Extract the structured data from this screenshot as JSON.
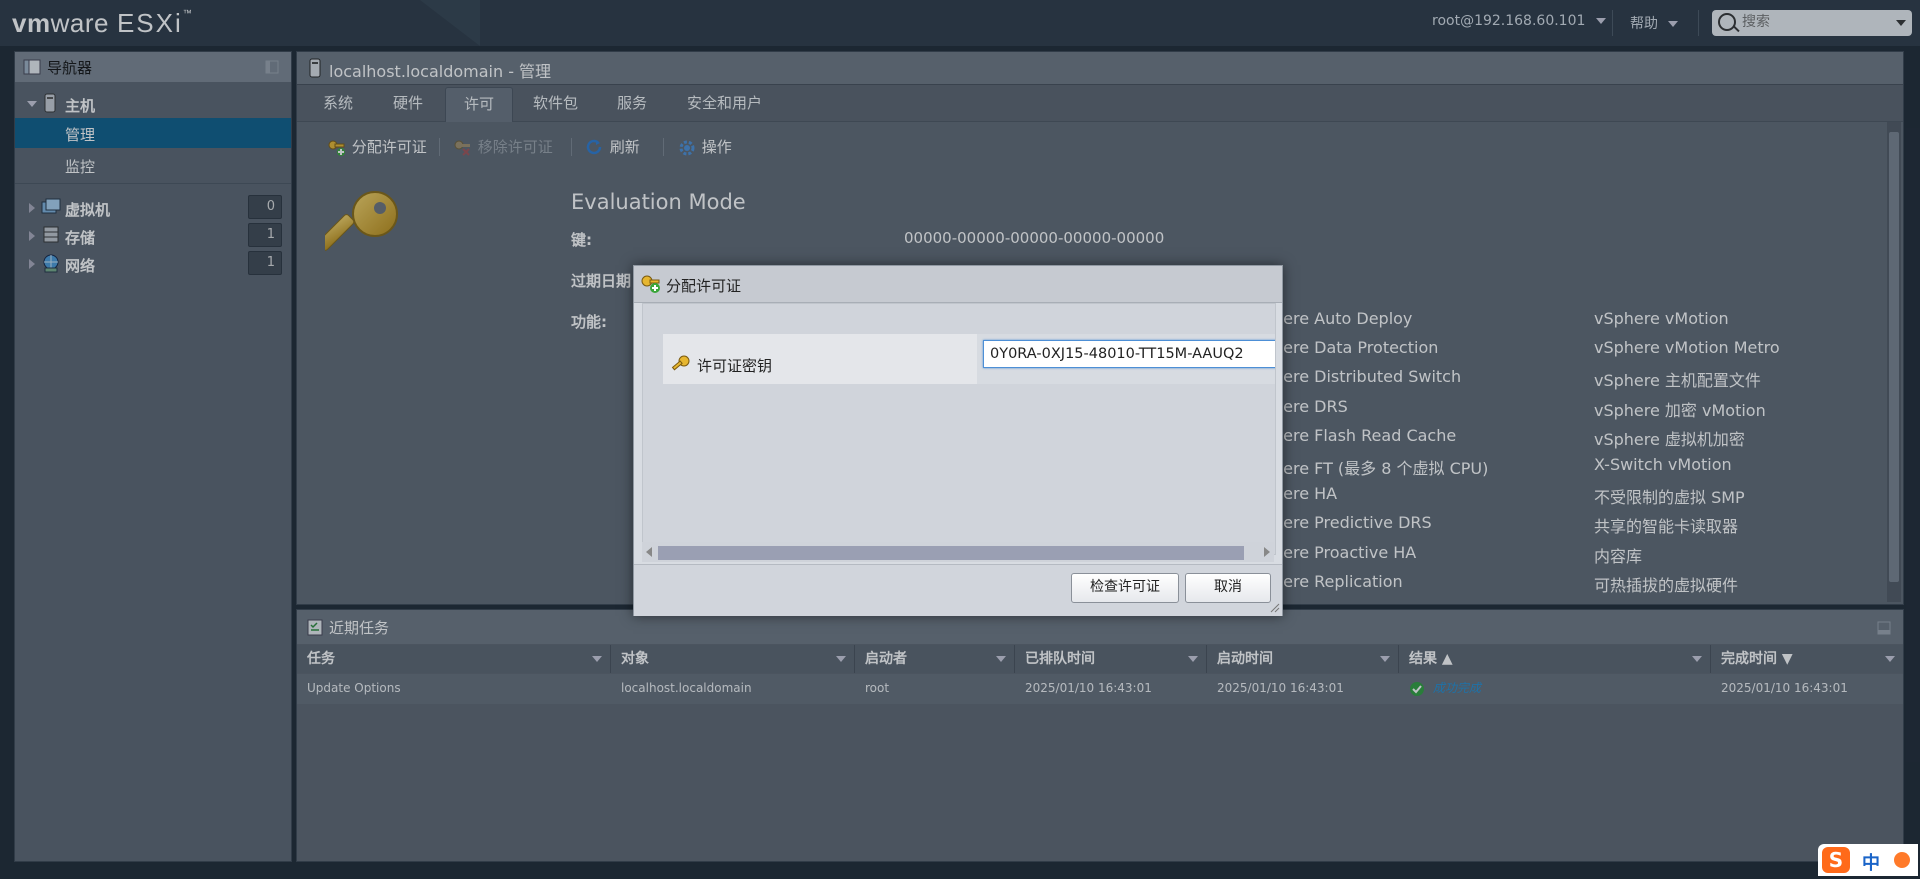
{
  "header": {
    "logo_vm": "vm",
    "logo_ware": "ware",
    "logo_esxi": "ESXi",
    "user": "root@192.168.60.101",
    "help": "帮助",
    "search_placeholder": "搜索"
  },
  "navigator": {
    "title": "导航器",
    "items": [
      {
        "label": "主机"
      },
      {
        "label": "管理"
      },
      {
        "label": "监控"
      },
      {
        "label": "虚拟机",
        "count": "0"
      },
      {
        "label": "存储",
        "count": "1"
      },
      {
        "label": "网络",
        "count": "1"
      }
    ]
  },
  "main": {
    "title": "localhost.localdomain - 管理",
    "tabs": [
      "系统",
      "硬件",
      "许可",
      "软件包",
      "服务",
      "安全和用户"
    ],
    "active_tab": "许可",
    "toolbar": {
      "assign": "分配许可证",
      "remove": "移除许可证",
      "refresh": "刷新",
      "actions": "操作"
    },
    "license": {
      "mode": "Evaluation Mode",
      "key_label": "键:",
      "key_value": "00000-00000-00000-00000-00000",
      "expiry_label": "过期日期",
      "features_label": "功能:",
      "features_col1": [
        "here Auto Deploy",
        "here Data Protection",
        "here Distributed Switch",
        "here DRS",
        "here Flash Read Cache",
        "here FT (最多 8 个虚拟 CPU)",
        "here HA",
        "here Predictive DRS",
        "here Proactive HA",
        "here Replication"
      ],
      "features_col2": [
        "vSphere vMotion",
        "vSphere vMotion Metro",
        "vSphere 主机配置文件",
        "vSphere 加密 vMotion",
        "vSphere 虚拟机加密",
        "X-Switch vMotion",
        "不受限制的虚拟 SMP",
        "共享的智能卡读取器",
        "内容库",
        "可热插拔的虚拟硬件"
      ]
    }
  },
  "tasks": {
    "title": "近期任务",
    "columns": [
      "任务",
      "对象",
      "启动者",
      "已排队时间",
      "启动时间",
      "结果 ▲",
      "完成时间 ▼"
    ],
    "rows": [
      [
        "Update Options",
        "localhost.localdomain",
        "root",
        "2025/01/10 16:43:01",
        "2025/01/10 16:43:01",
        "成功完成",
        "2025/01/10 16:43:01"
      ]
    ]
  },
  "dialog": {
    "title": "分配许可证",
    "field_label": "许可证密钥",
    "field_value": "0Y0RA-0XJ15-48010-TT15M-AAUQ2",
    "check_button": "检查许可证",
    "cancel_button": "取消"
  },
  "ime": {
    "s": "S",
    "lang": "中"
  },
  "colors": {
    "header_bg": "#2b3846",
    "nav_selected": "#0a5d8a",
    "success": "#2e9e3e",
    "success_text": "#1f8fd6",
    "input_focus": "#4d8fd6"
  }
}
